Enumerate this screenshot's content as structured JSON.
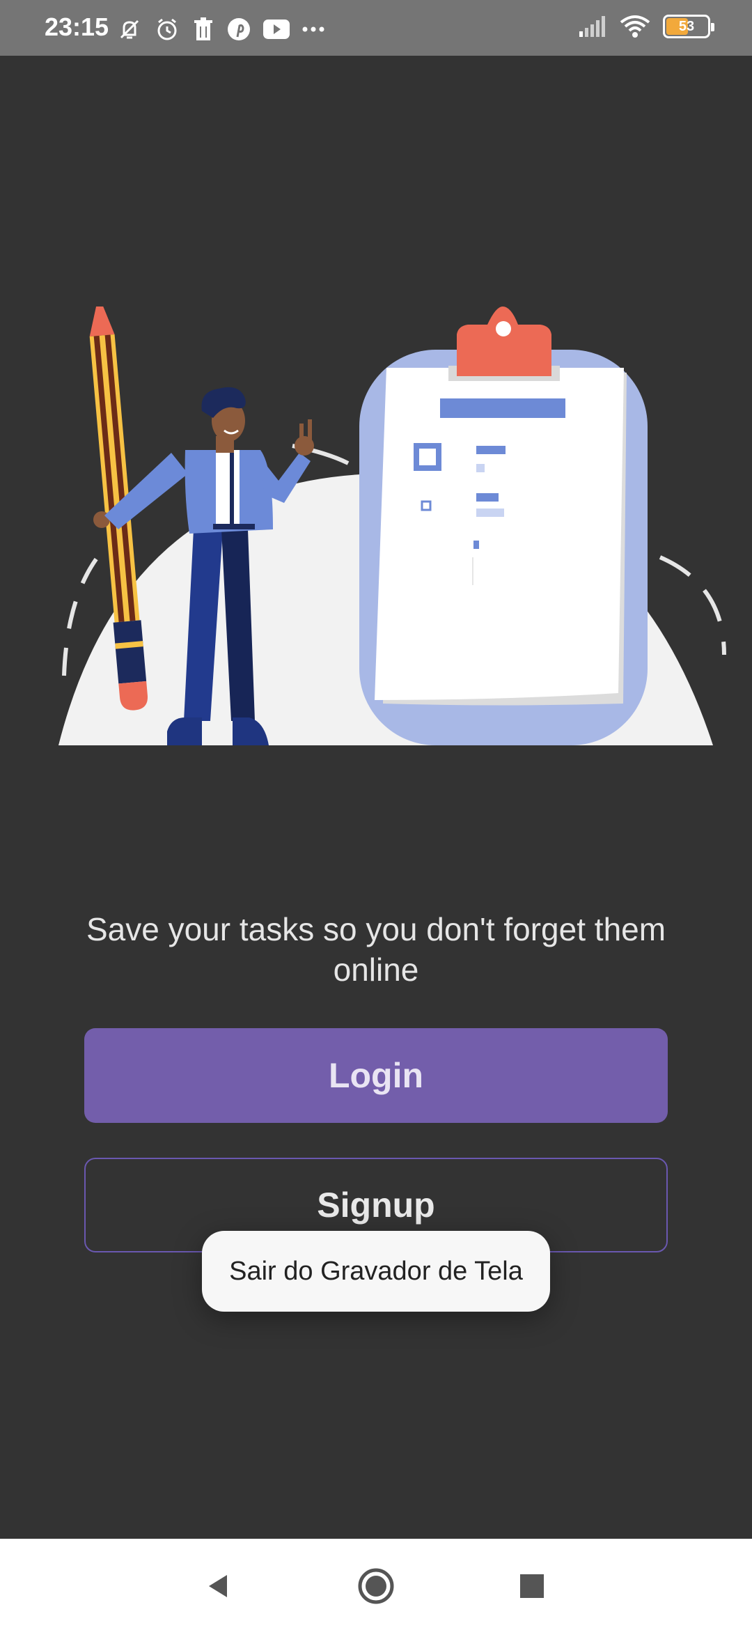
{
  "status_bar": {
    "time": "23:15",
    "left_icons": [
      "mute-icon",
      "alarm-icon",
      "clipboard-icon",
      "pinterest-icon",
      "youtube-icon",
      "more-dots-icon"
    ],
    "battery_percent": "53",
    "battery_level": 0.53
  },
  "main": {
    "tagline": "Save your tasks so you don't forget them online",
    "login_label": "Login",
    "signup_label": "Signup"
  },
  "toast": {
    "text": "Sair do Gravador de Tela"
  },
  "colors": {
    "background": "#333333",
    "accent": "#735eab",
    "status_bar": "#757575"
  },
  "nav_bar": {
    "buttons": [
      "back-icon",
      "home-icon",
      "recents-icon"
    ]
  }
}
